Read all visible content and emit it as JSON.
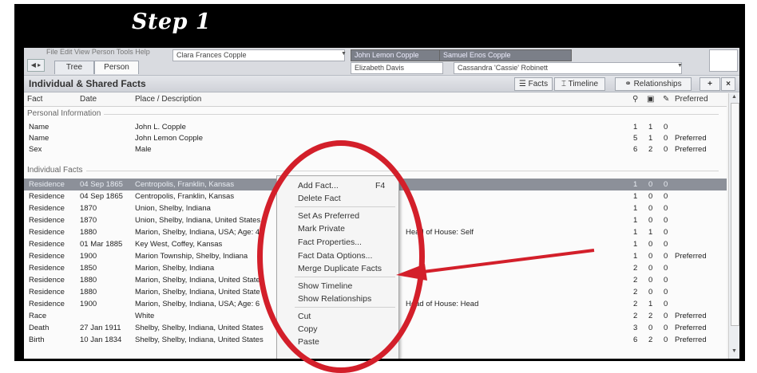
{
  "banner": {
    "title": "Step 1"
  },
  "toolbar": {
    "faint_menu": "File  Edit  View  Person  Tools  Help",
    "nav_back": "◀ ▸",
    "tabs": [
      "Tree",
      "Person"
    ],
    "person_combo": "Clara Frances Copple",
    "selected_combo": "John Lemon Copple",
    "spouse_combo": "Elizabeth Davis",
    "right_combo_top": "Samuel Enos Copple",
    "right_combo": "Cassandra 'Cassie' Robinett"
  },
  "pane": {
    "title": "Individual & Shared Facts",
    "buttons": {
      "facts": "Facts",
      "timeline": "Timeline",
      "relationships": "Relationships",
      "add": "+",
      "close": "×"
    }
  },
  "columns": {
    "fact": "Fact",
    "date": "Date",
    "place": "Place / Description",
    "preferred": "Preferred"
  },
  "groups": {
    "personal": "Personal Information",
    "individual": "Individual Facts"
  },
  "personal_rows": [
    {
      "fact": "Name",
      "date": "",
      "place": "John L. Copple",
      "s": "1",
      "m": "1",
      "n": "0",
      "pref": ""
    },
    {
      "fact": "Name",
      "date": "",
      "place": "John Lemon Copple",
      "s": "5",
      "m": "1",
      "n": "0",
      "pref": "Preferred"
    },
    {
      "fact": "Sex",
      "date": "",
      "place": "Male",
      "s": "6",
      "m": "2",
      "n": "0",
      "pref": "Preferred"
    }
  ],
  "fact_rows": [
    {
      "fact": "Residence",
      "date": "04 Sep 1865",
      "place": "Centropolis, Franklin, Kansas",
      "extra": "",
      "s": "1",
      "m": "0",
      "n": "0",
      "pref": ""
    },
    {
      "fact": "Residence",
      "date": "04 Sep 1865",
      "place": "Centropolis, Franklin, Kansas",
      "extra": "",
      "s": "1",
      "m": "0",
      "n": "0",
      "pref": ""
    },
    {
      "fact": "Residence",
      "date": "1870",
      "place": "Union, Shelby, Indiana",
      "extra": "",
      "s": "1",
      "m": "0",
      "n": "0",
      "pref": ""
    },
    {
      "fact": "Residence",
      "date": "1870",
      "place": "Union, Shelby, Indiana, United States",
      "extra": "",
      "s": "1",
      "m": "0",
      "n": "0",
      "pref": ""
    },
    {
      "fact": "Residence",
      "date": "1880",
      "place": "Marion, Shelby, Indiana, USA; Age: 4",
      "extra": "Head of House: Self",
      "s": "1",
      "m": "1",
      "n": "0",
      "pref": ""
    },
    {
      "fact": "Residence",
      "date": "01 Mar 1885",
      "place": "Key West, Coffey, Kansas",
      "extra": "",
      "s": "1",
      "m": "0",
      "n": "0",
      "pref": ""
    },
    {
      "fact": "Residence",
      "date": "1900",
      "place": "Marion Township, Shelby, Indiana",
      "extra": "",
      "s": "1",
      "m": "0",
      "n": "0",
      "pref": "Preferred"
    },
    {
      "fact": "Residence",
      "date": "1850",
      "place": "Marion, Shelby, Indiana",
      "extra": "",
      "s": "2",
      "m": "0",
      "n": "0",
      "pref": ""
    },
    {
      "fact": "Residence",
      "date": "1880",
      "place": "Marion, Shelby, Indiana, United State",
      "extra": "",
      "s": "2",
      "m": "0",
      "n": "0",
      "pref": ""
    },
    {
      "fact": "Residence",
      "date": "1880",
      "place": "Marion, Shelby, Indiana, United State",
      "extra": "",
      "s": "2",
      "m": "0",
      "n": "0",
      "pref": ""
    },
    {
      "fact": "Residence",
      "date": "1900",
      "place": "Marion, Shelby, Indiana, USA; Age: 6",
      "extra": "Head of House: Head",
      "s": "2",
      "m": "1",
      "n": "0",
      "pref": ""
    },
    {
      "fact": "Race",
      "date": "",
      "place": "White",
      "extra": "",
      "s": "2",
      "m": "2",
      "n": "0",
      "pref": "Preferred"
    },
    {
      "fact": "Death",
      "date": "27 Jan 1911",
      "place": "Shelby, Shelby, Indiana, United States",
      "extra": "",
      "s": "3",
      "m": "0",
      "n": "0",
      "pref": "Preferred"
    },
    {
      "fact": "Birth",
      "date": "10 Jan 1834",
      "place": "Shelby, Shelby, Indiana, United States",
      "extra": "",
      "s": "6",
      "m": "2",
      "n": "0",
      "pref": "Preferred"
    }
  ],
  "context_menu": {
    "items": [
      "Add Fact...",
      "Delete Fact",
      "Set As Preferred",
      "Mark Private",
      "Fact Properties...",
      "Fact Data Options...",
      "Merge Duplicate Facts",
      "Show Timeline",
      "Show Relationships",
      "Cut",
      "Copy",
      "Paste"
    ],
    "shortcut_add": "F4"
  },
  "colors": {
    "annotation": "#d31f2a",
    "selection": "#8c9099"
  }
}
